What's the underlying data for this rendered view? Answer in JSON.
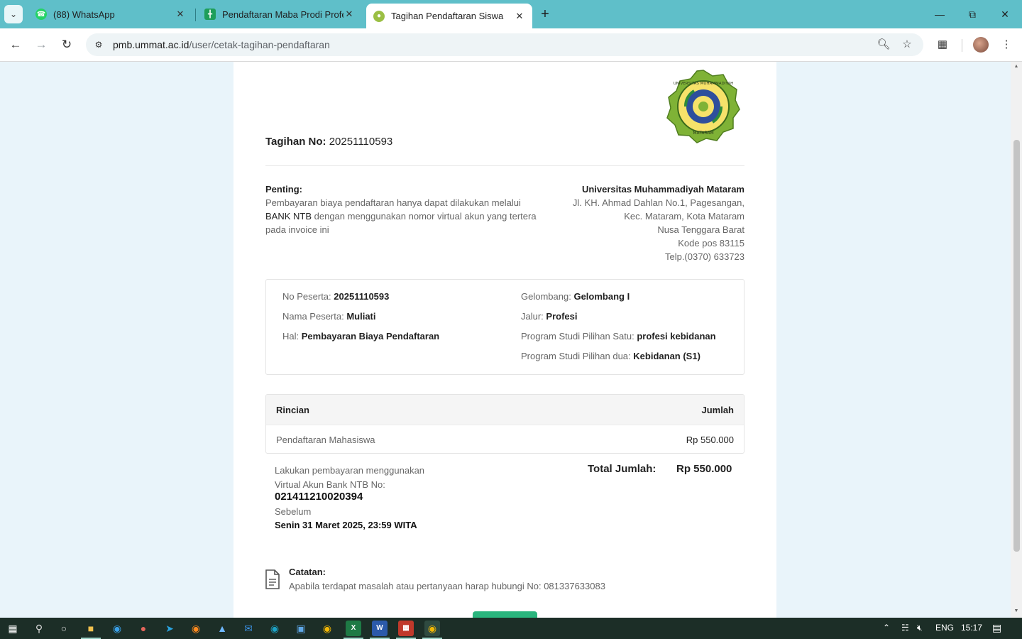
{
  "browser": {
    "tabs": [
      {
        "title": "(88) WhatsApp",
        "active": false
      },
      {
        "title": "Pendaftaran Maba Prodi Profesi",
        "active": false
      },
      {
        "title": "Tagihan Pendaftaran Siswa",
        "active": true
      }
    ],
    "url_host": "pmb.ummat.ac.id",
    "url_path": "/user/cetak-tagihan-pendaftaran"
  },
  "invoice": {
    "number_label": "Tagihan No:",
    "number": "20251110593",
    "important_head": "Penting:",
    "important_pre": "Pembayaran biaya pendaftaran hanya dapat dilakukan melalui ",
    "important_bank": "BANK NTB",
    "important_post": " dengan menggunakan nomor virtual akun yang tertera pada invoice ini",
    "address": {
      "name": "Universitas Muhammadiyah Mataram",
      "line1": "Jl. KH. Ahmad Dahlan No.1, Pagesangan,",
      "line2": "Kec. Mataram, Kota Mataram",
      "line3": "Nusa Tenggara Barat",
      "line4": "Kode pos 83115",
      "line5": "Telp.(0370) 633723"
    },
    "details": {
      "no_peserta_label": "No Peserta:",
      "no_peserta": "20251110593",
      "nama_label": "Nama Peserta:",
      "nama": "Muliati",
      "hal_label": "Hal:",
      "hal": "Pembayaran Biaya Pendaftaran",
      "gelombang_label": "Gelombang:",
      "gelombang": "Gelombang I",
      "jalur_label": "Jalur:",
      "jalur": "Profesi",
      "prodi1_label": "Program Studi Pilihan Satu:",
      "prodi1": "profesi kebidanan",
      "prodi2_label": "Program Studi Pilihan dua:",
      "prodi2": "Kebidanan (S1)"
    },
    "table": {
      "col_detail": "Rincian",
      "col_amount": "Jumlah",
      "rows": [
        {
          "item": "Pendaftaran Mahasiswa",
          "amount": "Rp 550.000"
        }
      ]
    },
    "payment": {
      "line1": "Lakukan pembayaran menggunakan",
      "line2": "Virtual Akun Bank NTB No:",
      "va_number": "021411210020394",
      "before_label": "Sebelum",
      "deadline": "Senin 31 Maret 2025, 23:59 WITA"
    },
    "total": {
      "label": "Total Jumlah:",
      "value": "Rp 550.000"
    },
    "note": {
      "head": "Catatan:",
      "text": "Apabila terdapat masalah atau pertanyaan harap hubungi No: 081337633083"
    },
    "seal_text": {
      "top": "UNIVERSITAS MUHAMMADIYAH",
      "bottom": "MATARAM"
    }
  },
  "taskbar": {
    "lang": "ENG",
    "time": "15:17"
  }
}
